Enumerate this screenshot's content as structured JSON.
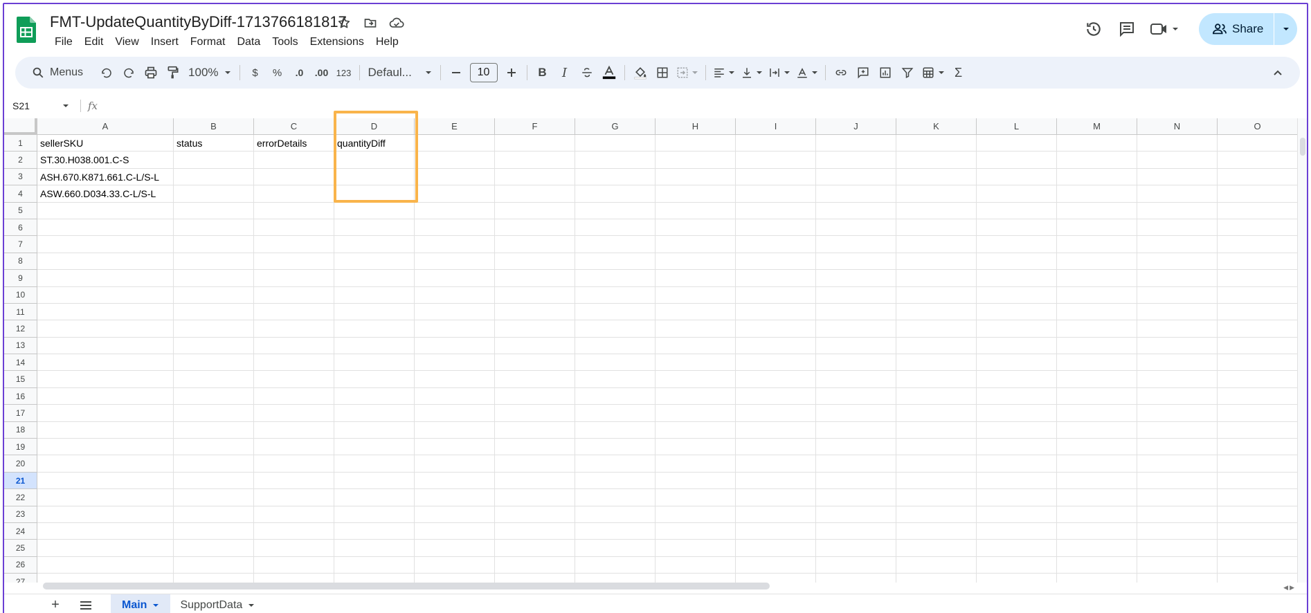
{
  "app": {
    "doc_title": "FMT-UpdateQuantityByDiff-1713766181817",
    "menu": [
      "File",
      "Edit",
      "View",
      "Insert",
      "Format",
      "Data",
      "Tools",
      "Extensions",
      "Help"
    ],
    "share_label": "Share"
  },
  "toolbar": {
    "search_label": "Menus",
    "zoom": "100%",
    "currency": "$",
    "percent": "%",
    "decrease_decimal": ".0",
    "increase_decimal": ".00",
    "number_format": "123",
    "font": "Defaul...",
    "font_size": "10"
  },
  "formula_bar": {
    "cell_ref": "S21",
    "fx": "fx"
  },
  "sheet": {
    "columns": [
      "A",
      "B",
      "C",
      "D",
      "E",
      "F",
      "G",
      "H",
      "I",
      "J",
      "K",
      "L",
      "M",
      "N",
      "O"
    ],
    "rows": [
      "1",
      "2",
      "3",
      "4",
      "5",
      "6",
      "7",
      "8",
      "9",
      "10",
      "11",
      "12",
      "13",
      "14",
      "15",
      "16",
      "17",
      "18",
      "19",
      "20",
      "21",
      "22",
      "23",
      "24",
      "25",
      "26",
      "27"
    ],
    "active_row": "21",
    "data": [
      [
        "sellerSKU",
        "status",
        "errorDetails",
        "quantityDiff"
      ],
      [
        "ST.30.H038.001.C-S",
        "",
        "",
        ""
      ],
      [
        "ASH.670.K871.661.C-L/S-L",
        "",
        "",
        ""
      ],
      [
        "ASW.660.D034.33.C-L/S-L",
        "",
        "",
        ""
      ]
    ]
  },
  "tabs": {
    "active": "Main",
    "other": "SupportData"
  }
}
